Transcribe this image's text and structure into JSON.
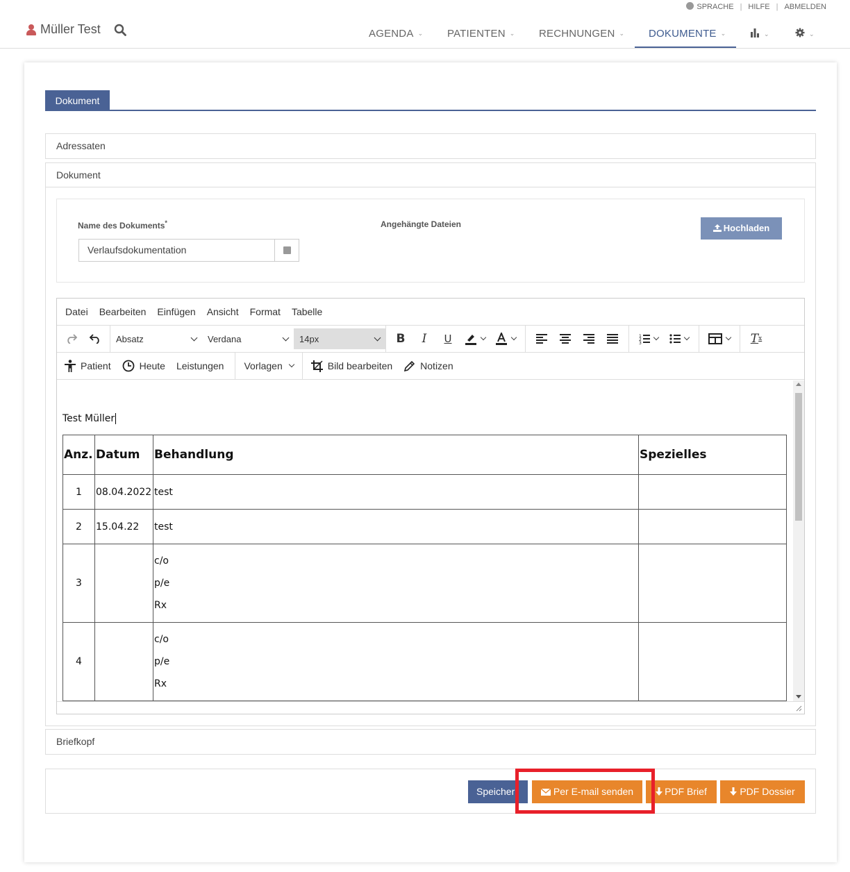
{
  "top_links": {
    "sprache": "SPRACHE",
    "hilfe": "HILFE",
    "abmelden": "ABMELDEN",
    "sep": "|"
  },
  "user": {
    "name": "Müller Test"
  },
  "nav": {
    "items": [
      "AGENDA",
      "PATIENTEN",
      "RECHNUNGEN",
      "DOKUMENTE"
    ],
    "active": "DOKUMENTE"
  },
  "tab": {
    "label": "Dokument"
  },
  "panels": {
    "adressaten": "Adressaten",
    "dokument": "Dokument",
    "briefkopf": "Briefkopf"
  },
  "form": {
    "name_label": "Name des Dokuments",
    "required_mark": "*",
    "name_value": "Verlaufsdokumentation",
    "attachments_label": "Angehängte Dateien",
    "upload_button": "Hochladen"
  },
  "editor": {
    "menu": [
      "Datei",
      "Bearbeiten",
      "Einfügen",
      "Ansicht",
      "Format",
      "Tabelle"
    ],
    "block_format": "Absatz",
    "font_family": "Verdana",
    "font_size": "14px",
    "toolbar2": {
      "patient": "Patient",
      "heute": "Heute",
      "leistungen": "Leistungen",
      "vorlagen": "Vorlagen",
      "bild": "Bild bearbeiten",
      "notizen": "Notizen"
    },
    "content": {
      "greeting": "Test Müller",
      "headers": [
        "Anz.",
        "Datum",
        "Behandlung",
        "Spezielles"
      ],
      "rows": [
        {
          "anz": "1",
          "datum": "08.04.2022",
          "behandlung": [
            "test"
          ],
          "spezielles": ""
        },
        {
          "anz": "2",
          "datum": "15.04.22",
          "behandlung": [
            "test"
          ],
          "spezielles": ""
        },
        {
          "anz": "3",
          "datum": "",
          "behandlung": [
            "c/o",
            "p/e",
            "Rx"
          ],
          "spezielles": ""
        },
        {
          "anz": "4",
          "datum": "",
          "behandlung": [
            "c/o",
            "p/e",
            "Rx"
          ],
          "spezielles": ""
        }
      ]
    }
  },
  "buttons": {
    "speichern": "Speicher",
    "email": "Per E-mail senden",
    "pdf_brief": "PDF Brief",
    "pdf_dossier": "PDF Dossier"
  },
  "colors": {
    "primary": "#4a6295",
    "orange": "#e8862b",
    "highlight": "#e8202a",
    "upload": "#7b91b8"
  }
}
